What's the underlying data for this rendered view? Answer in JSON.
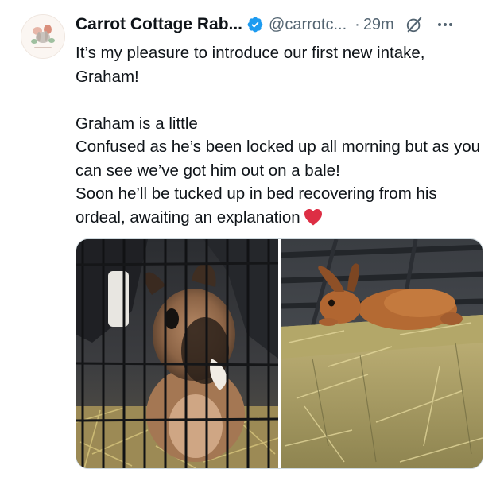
{
  "tweet": {
    "display_name": "Carrot Cottage Rab...",
    "handle": "@carrotc...",
    "separator": "·",
    "time": "29m",
    "paragraphs": [
      "It’s my pleasure to introduce our first new intake, Graham!",
      "",
      "Graham is a little",
      "Confused as he’s been locked up all morning but as you can see we’ve got him out on a bale!",
      "Soon he’ll be tucked up in bed recovering from his ordeal,  awaiting an explanation"
    ]
  },
  "icons": {
    "verified": "verified-badge-icon",
    "grok": "grok-icon",
    "more": "more-options-icon",
    "heart": "red-heart-emoji"
  },
  "colors": {
    "verified": "#1d9bf0",
    "secondary_text": "#536471",
    "heart": "#e0245e"
  },
  "media": {
    "count": 2,
    "items": [
      "rabbit-in-cage-photo",
      "rabbit-on-hay-bale-photo"
    ]
  }
}
